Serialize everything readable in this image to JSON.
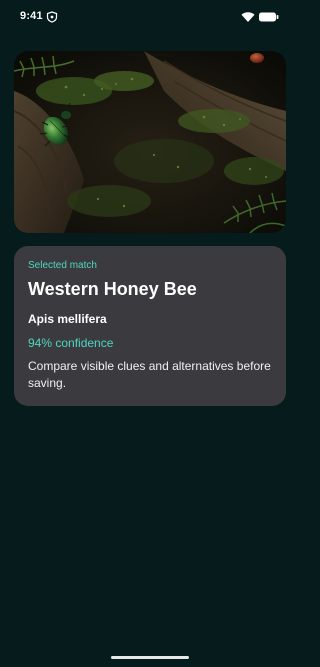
{
  "status_bar": {
    "time": "9:41",
    "icons": [
      "shield-icon",
      "wifi-icon",
      "battery-icon"
    ]
  },
  "hero": {
    "image": "beetle-on-mossy-log-photo"
  },
  "result": {
    "eyebrow": "Selected match",
    "common_name": "Western Honey Bee",
    "scientific_name": "Apis mellifera",
    "confidence": "94% confidence",
    "note": "Compare visible clues and alternatives before saving."
  },
  "colors": {
    "background": "#061c1c",
    "card": "#3b3b3f",
    "accent": "#4fd6c2"
  }
}
